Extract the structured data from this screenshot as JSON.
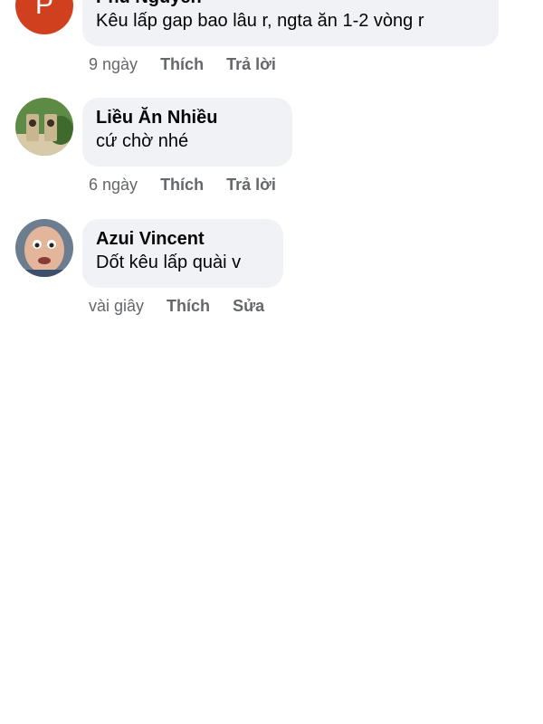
{
  "comments": [
    {
      "author": "Phú Nguyễn",
      "avatar_letter": "P",
      "text": "Kêu lấp gap bao lâu r, ngta ăn 1-2 vòng r",
      "time": "9 ngày",
      "actions": [
        "Thích",
        "Trả lời"
      ]
    },
    {
      "author": "Liều Ăn Nhiều",
      "text": "cứ chờ nhé",
      "time": "6 ngày",
      "actions": [
        "Thích",
        "Trả lời"
      ]
    },
    {
      "author": "Azui Vincent",
      "text": "Dốt kêu lấp quài v",
      "time": "vài giây",
      "actions": [
        "Thích",
        "Sửa"
      ]
    }
  ]
}
